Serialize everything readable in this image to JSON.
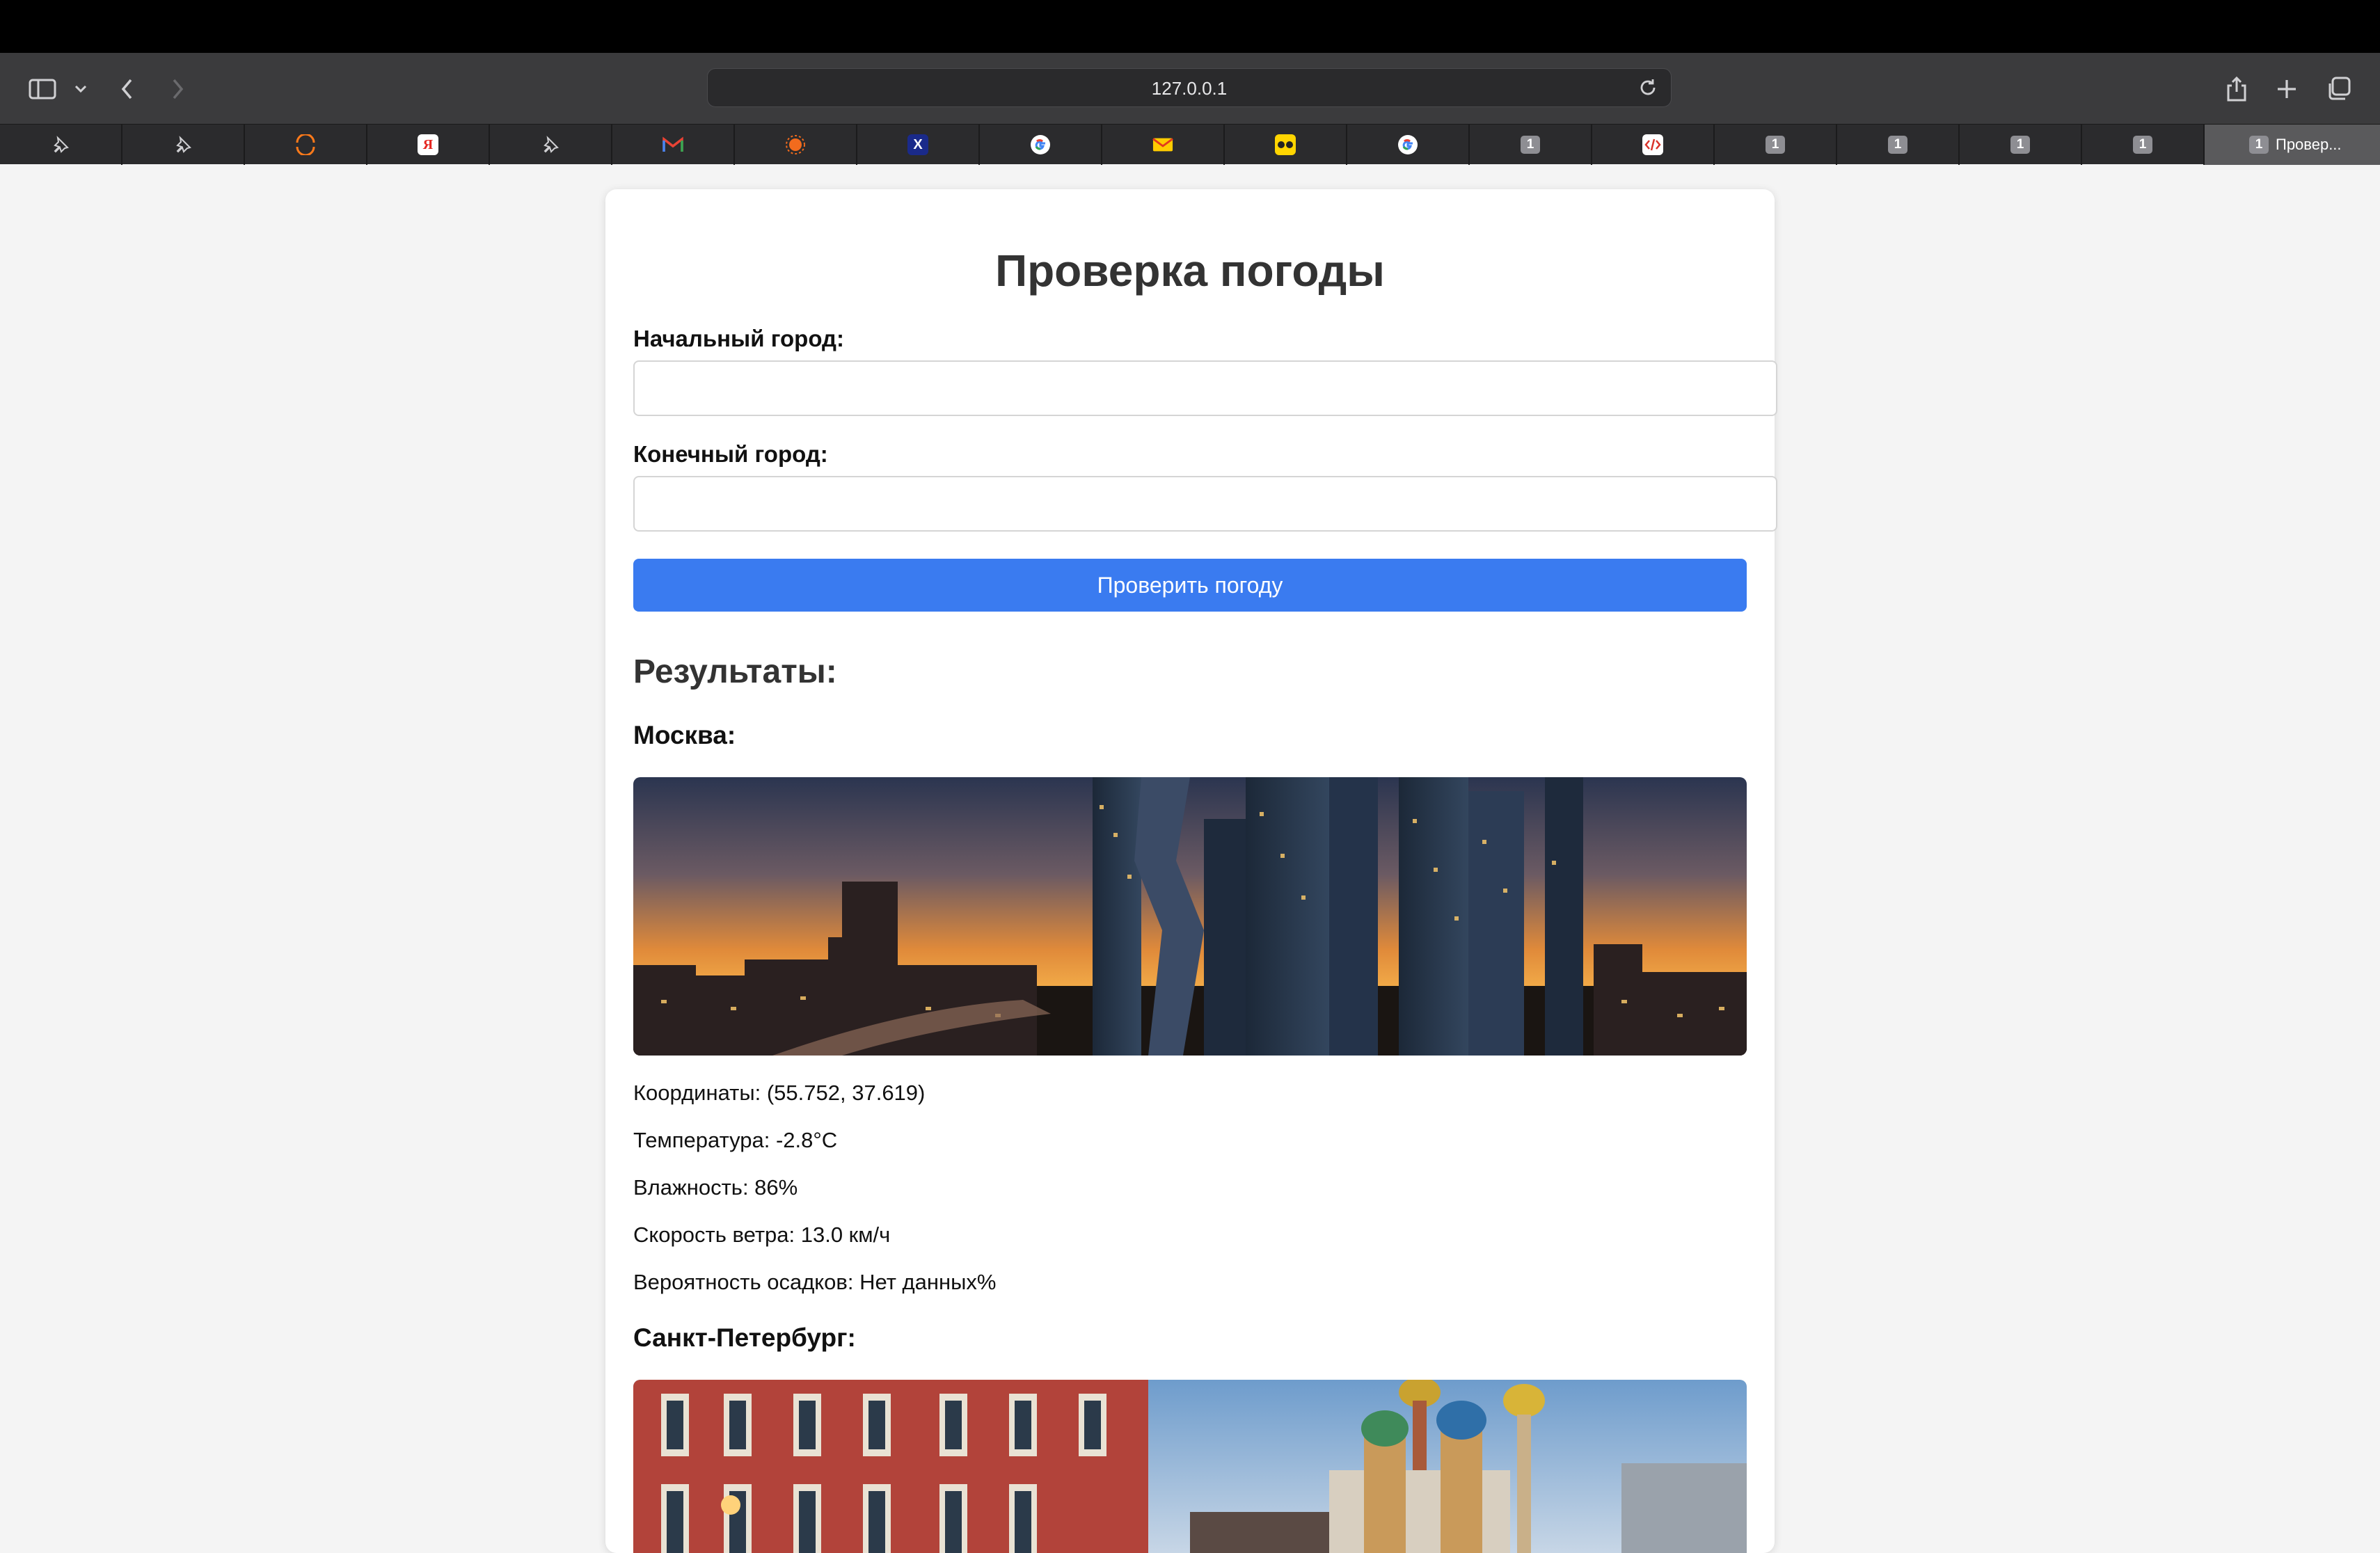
{
  "browser": {
    "url": "127.0.0.1",
    "active_tab_label": "Провер...",
    "tabs": [
      {
        "icon": "pin-icon"
      },
      {
        "icon": "pin-icon"
      },
      {
        "icon": "orange-arc-icon"
      },
      {
        "icon": "yandex-icon"
      },
      {
        "icon": "pin-icon"
      },
      {
        "icon": "gmail-icon"
      },
      {
        "icon": "orange-sun-icon"
      },
      {
        "icon": "x-icon"
      },
      {
        "icon": "google-icon"
      },
      {
        "icon": "mail-envelope-icon"
      },
      {
        "icon": "yellow-glasses-icon"
      },
      {
        "icon": "google-icon"
      },
      {
        "icon": "number-icon",
        "num": "1"
      },
      {
        "icon": "code-icon"
      },
      {
        "icon": "number-icon",
        "num": "1"
      },
      {
        "icon": "number-icon",
        "num": "1"
      },
      {
        "icon": "number-icon",
        "num": "1"
      },
      {
        "icon": "number-icon",
        "num": "1"
      },
      {
        "icon": "number-icon",
        "num": "1"
      }
    ]
  },
  "page": {
    "title": "Проверка погоды",
    "start_city_label": "Начальный город:",
    "start_city_value": "",
    "end_city_label": "Конечный город:",
    "end_city_value": "",
    "submit_label": "Проверить погоду",
    "results_heading": "Результаты:",
    "cities": [
      {
        "name": "Москва:",
        "coordinates": "Координаты: (55.752, 37.619)",
        "temperature": "Температура: -2.8°C",
        "humidity": "Влажность: 86%",
        "wind": "Скорость ветра: 13.0 км/ч",
        "precipitation": "Вероятность осадков: Нет данных%"
      },
      {
        "name": "Санкт-Петербург:"
      }
    ]
  },
  "colors": {
    "accent": "#3a7bf0",
    "page_bg": "#f4f4f4",
    "chrome_bg": "#3b3b3d"
  }
}
